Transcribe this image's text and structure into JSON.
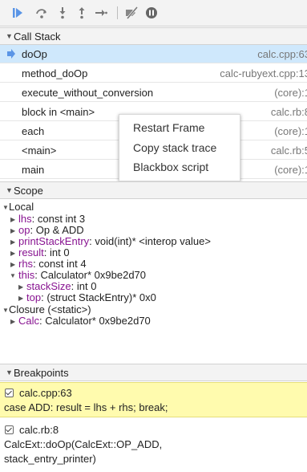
{
  "toolbar": {
    "buttons": [
      {
        "name": "resume",
        "icon": "resume-icon",
        "color": "#5a95e6"
      },
      {
        "name": "step-over",
        "icon": "step-over-icon"
      },
      {
        "name": "step-into",
        "icon": "step-into-icon"
      },
      {
        "name": "step-out",
        "icon": "step-out-icon"
      },
      {
        "name": "step",
        "icon": "step-icon"
      },
      {
        "name": "deactivate-breakpoints",
        "icon": "deactivate-breakpoints-icon"
      },
      {
        "name": "pause-on-exceptions",
        "icon": "pause-on-exceptions-icon"
      }
    ]
  },
  "call_stack": {
    "title": "Call Stack",
    "frames": [
      {
        "name": "doOp",
        "location": "calc.cpp:63",
        "selected": true
      },
      {
        "name": "method_doOp",
        "location": "calc-rubyext.cpp:13"
      },
      {
        "name": "execute_without_conversion",
        "location": "(core):1"
      },
      {
        "name": "block in <main>",
        "location": "calc.rb:8"
      },
      {
        "name": "each",
        "location": "(core):1"
      },
      {
        "name": "<main>",
        "location": "calc.rb:5"
      },
      {
        "name": "main",
        "location": "(core):1"
      }
    ]
  },
  "context_menu": {
    "items": [
      "Restart Frame",
      "Copy stack trace",
      "Blackbox script"
    ]
  },
  "scope": {
    "title": "Scope",
    "local_label": "Local",
    "local_vars": [
      {
        "name": "lhs",
        "value": "const int 3",
        "expanded": false
      },
      {
        "name": "op",
        "value": "Op & ADD",
        "expanded": false
      },
      {
        "name": "printStackEntry",
        "value": "void(int)* <interop value>",
        "expanded": false
      },
      {
        "name": "result",
        "value": "int 0",
        "expanded": false
      },
      {
        "name": "rhs",
        "value": "const int 4",
        "expanded": false
      },
      {
        "name": "this",
        "value": "Calculator* 0x9be2d70",
        "expanded": true
      }
    ],
    "this_children": [
      {
        "name": "stackSize",
        "value": "int 0"
      },
      {
        "name": "top",
        "value": "(struct StackEntry)* 0x0"
      }
    ],
    "closure_label": "Closure (<static>)",
    "closure_vars": [
      {
        "name": "Calc",
        "value": "Calculator* 0x9be2d70"
      }
    ]
  },
  "breakpoints": {
    "title": "Breakpoints",
    "items": [
      {
        "location": "calc.cpp:63",
        "code": [
          "case ADD: result = lhs + rhs; break;"
        ],
        "hit": true
      },
      {
        "location": "calc.rb:8",
        "code": [
          "CalcExt::doOp(CalcExt::OP_ADD,",
          "stack_entry_printer)"
        ],
        "hit": false
      }
    ]
  },
  "colors": {
    "accent": "#5a95e6",
    "property_name": "#881391",
    "selected_row": "#cfe8fc",
    "breakpoint_hit": "#fffbae"
  }
}
